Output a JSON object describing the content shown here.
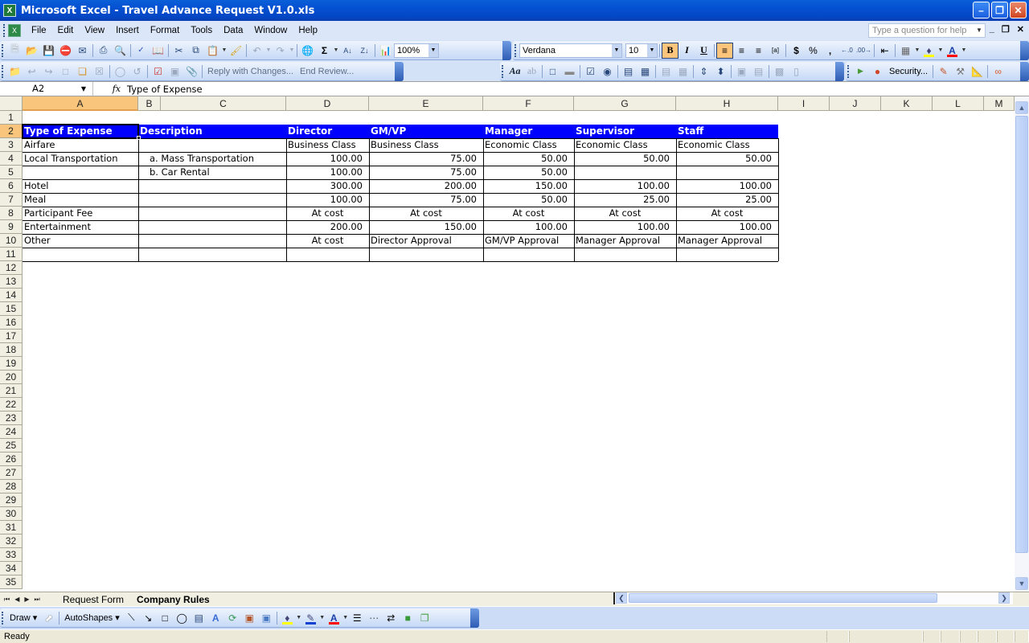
{
  "window": {
    "title": "Microsoft Excel - Travel Advance Request V1.0.xls",
    "app_icon": "excel-icon",
    "controls": [
      "minimize",
      "restore",
      "close"
    ]
  },
  "menubar": {
    "items": [
      "File",
      "Edit",
      "View",
      "Insert",
      "Format",
      "Tools",
      "Data",
      "Window",
      "Help"
    ],
    "help_placeholder": "Type a question for help"
  },
  "standard_toolbar": {
    "zoom": "100%",
    "icons": [
      "new-icon",
      "open-icon",
      "save-icon",
      "permission-icon",
      "email-icon",
      "print-icon",
      "print-preview-icon",
      "spelling-icon",
      "research-icon",
      "cut-icon",
      "copy-icon",
      "paste-icon",
      "format-painter-icon",
      "undo-icon",
      "redo-icon",
      "hyperlink-icon",
      "autosum-icon",
      "sort-ascending-icon",
      "sort-descending-icon",
      "chart-wizard-icon"
    ]
  },
  "formatting_toolbar": {
    "font": "Verdana",
    "size": "10",
    "bold_active": true,
    "align_left_active": true,
    "icons": [
      "bold-icon",
      "italic-icon",
      "underline-icon",
      "align-left-icon",
      "align-center-icon",
      "align-right-icon",
      "merge-center-icon",
      "currency-icon",
      "percent-icon",
      "comma-icon",
      "increase-decimal-icon",
      "decrease-decimal-icon",
      "indent-icon",
      "borders-icon",
      "fill-color-icon",
      "font-color-icon"
    ]
  },
  "reviewing_toolbar": {
    "reply_label": "Reply with Changes...",
    "end_review_label": "End Review..."
  },
  "visual_basic_toolbar": {
    "security_label": "Security..."
  },
  "formula_bar": {
    "name_box": "A2",
    "fx": "fx",
    "content": "Type of Expense"
  },
  "sheet": {
    "columns": [
      "A",
      "B",
      "C",
      "D",
      "E",
      "F",
      "G",
      "H",
      "I",
      "J",
      "K",
      "L",
      "M"
    ],
    "selected_column": "A",
    "selected_row": 2,
    "row_numbers": [
      1,
      2,
      3,
      4,
      5,
      6,
      7,
      8,
      9,
      10,
      11,
      12,
      13,
      14,
      15,
      16,
      17,
      18,
      19,
      20,
      21,
      22,
      23,
      24,
      25,
      26,
      27,
      28,
      29,
      30,
      31,
      32,
      33,
      34,
      35
    ],
    "header_row": [
      "Type of Expense",
      "Description",
      "Director",
      "GM/VP",
      "Manager",
      "Supervisor",
      "Staff"
    ],
    "rows": [
      {
        "type": "Airfare",
        "desc": "",
        "values": [
          "Business Class",
          "Business Class",
          "Economic Class",
          "Economic Class",
          "Economic Class"
        ]
      },
      {
        "type": "Local Transportation",
        "desc": "a. Mass Transportation",
        "values": [
          "100.00",
          "75.00",
          "50.00",
          "50.00",
          "50.00"
        ]
      },
      {
        "type": "",
        "desc": "b. Car Rental",
        "values": [
          "100.00",
          "75.00",
          "50.00",
          "",
          ""
        ]
      },
      {
        "type": "Hotel",
        "desc": "",
        "values": [
          "300.00",
          "200.00",
          "150.00",
          "100.00",
          "100.00"
        ]
      },
      {
        "type": "Meal",
        "desc": "",
        "values": [
          "100.00",
          "75.00",
          "50.00",
          "25.00",
          "25.00"
        ]
      },
      {
        "type": "Participant Fee",
        "desc": "",
        "values": [
          "At cost",
          "At cost",
          "At cost",
          "At cost",
          "At cost"
        ]
      },
      {
        "type": "Entertainment",
        "desc": "",
        "values": [
          "200.00",
          "150.00",
          "100.00",
          "100.00",
          "100.00"
        ]
      },
      {
        "type": "Other",
        "desc": "",
        "values": [
          "At cost",
          "Director Approval",
          "GM/VP Approval",
          "Manager Approval",
          "Manager Approval"
        ]
      },
      {
        "type": "",
        "desc": "",
        "values": [
          "",
          "",
          "",
          "",
          ""
        ]
      }
    ],
    "header_color": "#0000FF"
  },
  "sheet_tabs": {
    "tabs": [
      "Request Form",
      "Company Rules"
    ],
    "active": "Company Rules"
  },
  "drawing_toolbar": {
    "draw_label": "Draw",
    "autoshapes_label": "AutoShapes"
  },
  "status": {
    "text": "Ready"
  }
}
